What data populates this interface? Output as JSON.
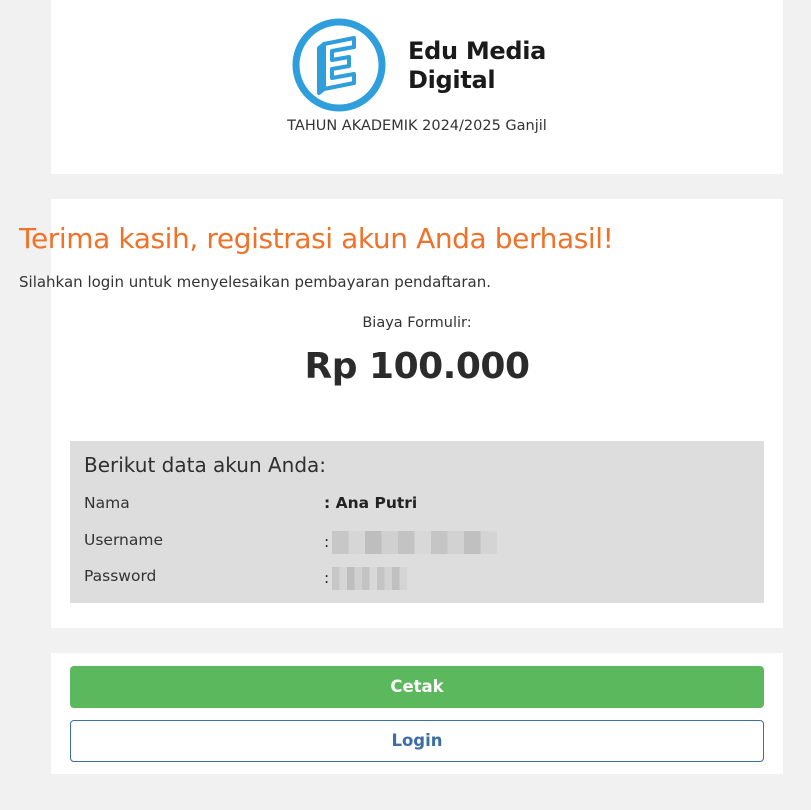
{
  "brand": {
    "name_line1": "Edu Media",
    "name_line2": "Digital",
    "logo_icon": "edu-media-e-logo",
    "logo_color": "#2e9fdc"
  },
  "academic_year": "TAHUN AKADEMIK 2024/2025 Ganjil",
  "confirmation": {
    "title": "Terima kasih, registrasi akun Anda berhasil!",
    "instruction": "Silahkan login untuk menyelesaikan pembayaran pendaftaran.",
    "fee_label": "Biaya Formulir:",
    "fee_amount": "Rp 100.000",
    "title_color": "#f07228"
  },
  "account": {
    "heading": "Berikut data akun Anda:",
    "rows": [
      {
        "label": "Nama",
        "value": ": Ana Putri",
        "masked": false
      },
      {
        "label": "Username",
        "value": ":",
        "masked": true
      },
      {
        "label": "Password",
        "value": ":",
        "masked": true
      }
    ]
  },
  "actions": {
    "print_label": "Cetak",
    "login_label": "Login",
    "print_color": "#5cb85c",
    "login_color": "#3a6ea5"
  }
}
